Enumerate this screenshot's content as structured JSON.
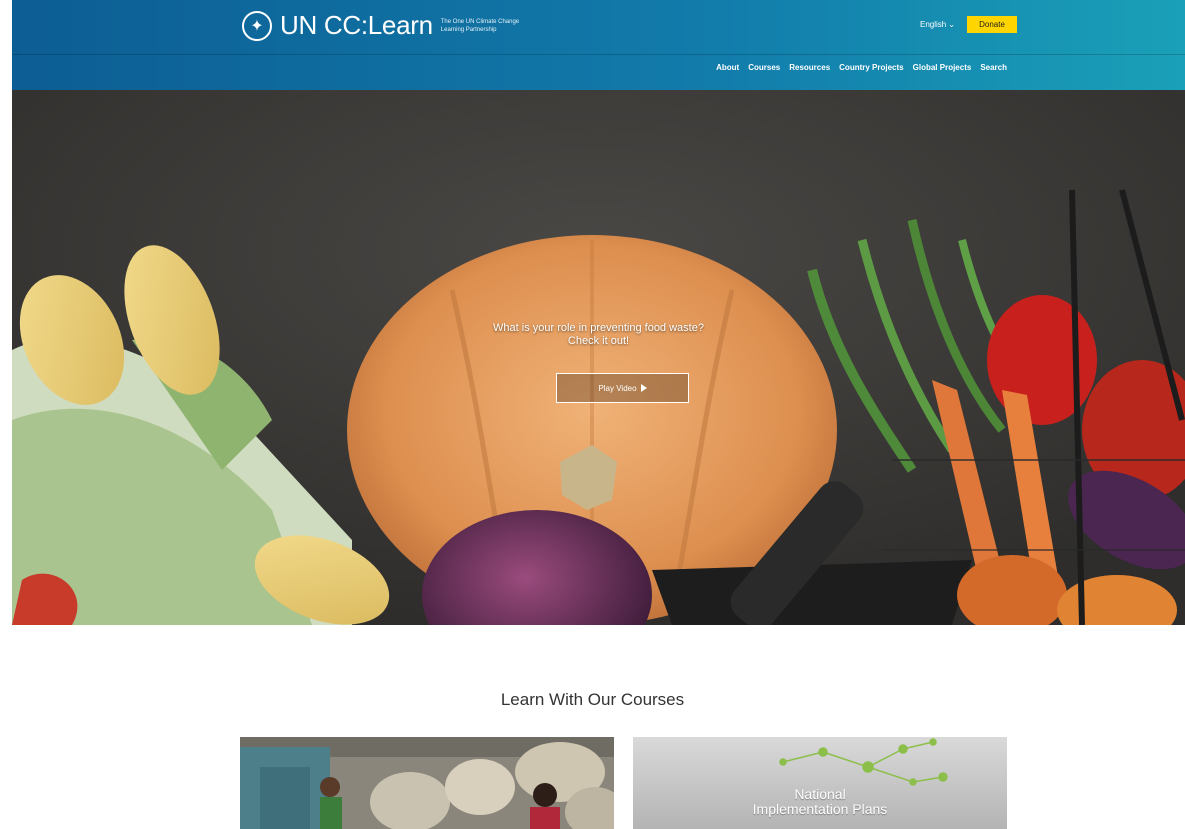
{
  "header": {
    "brand_name": "UN CC:Learn",
    "tagline": "The One UN Climate Change Learning Partnership",
    "language": "English",
    "donate_label": "Donate",
    "nav": [
      {
        "label": "About"
      },
      {
        "label": "Courses"
      },
      {
        "label": "Resources"
      },
      {
        "label": "Country Projects"
      },
      {
        "label": "Global Projects"
      },
      {
        "label": "Search"
      }
    ]
  },
  "hero": {
    "line1": "What is your role in preventing food waste?",
    "line2": "Check it out!",
    "play_label": "Play Video"
  },
  "courses": {
    "title": "Learn With Our Courses",
    "cards": [
      {
        "label": ""
      },
      {
        "label_line1": "National",
        "label_line2": "Implementation Plans"
      }
    ]
  },
  "colors": {
    "header_start": "#0c5d93",
    "header_end": "#1aa0b8",
    "donate_bg": "#ffd500"
  }
}
